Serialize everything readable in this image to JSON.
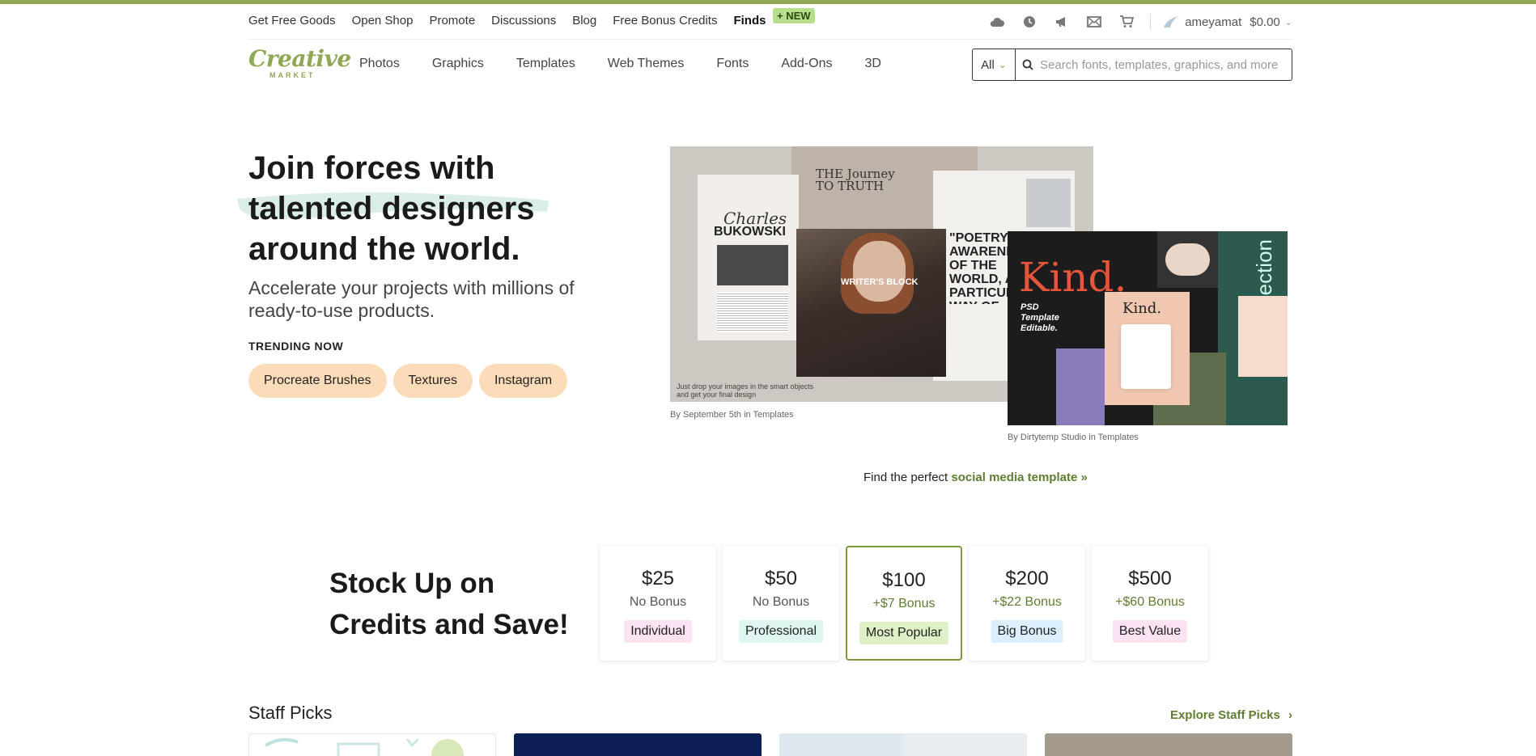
{
  "topnav": {
    "links": [
      "Get Free Goods",
      "Open Shop",
      "Promote",
      "Discussions",
      "Blog",
      "Free Bonus Credits",
      "Finds"
    ],
    "new_badge": "+ NEW",
    "icons": [
      "cloud-icon",
      "clock-icon",
      "megaphone-icon",
      "mail-icon",
      "cart-icon"
    ],
    "username": "ameyamat",
    "balance": "$0.00"
  },
  "mainnav": {
    "logo_top": "Creative",
    "logo_bottom": "MARKET",
    "categories": [
      "Photos",
      "Graphics",
      "Templates",
      "Web Themes",
      "Fonts",
      "Add-Ons",
      "3D"
    ],
    "search": {
      "category": "All",
      "placeholder": "Search fonts, templates, graphics, and more"
    }
  },
  "hero": {
    "title_line1": "Join forces with",
    "title_line2": "talented designers",
    "title_line3": "around the world.",
    "subtitle": "Accelerate your projects with millions of ready-to-use products.",
    "trending_label": "TRENDING NOW",
    "trending": [
      "Procreate Brushes",
      "Textures",
      "Instagram"
    ],
    "image1": {
      "name1": "Charles",
      "name2": "BUKOWSKI",
      "journey1": "THE Journey",
      "journey2": "TO TRUTH",
      "poetry": "\"POETRY IS AN AWARENESS OF THE WORLD, A PARTICULAR WAY OF RELATING TO REALITY",
      "writers": "WRITER'S BLOCK",
      "caption": "Just drop your images in the smart objects and get your final design",
      "credit": "By September 5th in Templates"
    },
    "image2": {
      "kind": "Kind.",
      "psd": "PSD Template Editable.",
      "kind_small": "Kind.",
      "collection": "collection",
      "credit": "By Dirtytemp Studio in Templates"
    },
    "find_prefix": "Find the perfect ",
    "find_link": "social media template »"
  },
  "credits": {
    "title": "Stock Up on Credits and Save!",
    "packages": [
      {
        "price": "$25",
        "bonus": "No Bonus",
        "tag": "Individual",
        "tag_color": "#fbe3f3"
      },
      {
        "price": "$50",
        "bonus": "No Bonus",
        "tag": "Professional",
        "tag_color": "#dff5ef"
      },
      {
        "price": "$100",
        "bonus": "+$7 Bonus",
        "tag": "Most Popular",
        "tag_color": "#dff0c6"
      },
      {
        "price": "$200",
        "bonus": "+$22 Bonus",
        "tag": "Big Bonus",
        "tag_color": "#dcefff"
      },
      {
        "price": "$500",
        "bonus": "+$60 Bonus",
        "tag": "Best Value",
        "tag_color": "#fbe3f3"
      }
    ]
  },
  "staff": {
    "title": "Staff Picks",
    "explore": "Explore Staff Picks"
  },
  "colors": {
    "brand": "#8fa853",
    "link_green": "#5f7e2f",
    "pill": "#fcdcb8"
  }
}
